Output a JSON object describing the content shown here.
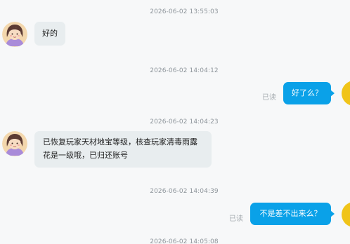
{
  "messages": [
    {
      "time": "2026-06-02 13:55:03",
      "sender": "user",
      "text": "好的"
    },
    {
      "time": "2026-06-02 14:04:12",
      "sender": "agent",
      "text": "好了么？",
      "status": "已读"
    },
    {
      "time": "2026-06-02 14:04:23",
      "sender": "user",
      "text": "已恢复玩家天材地宝等级，核查玩家清毒雨露花是一级哦，已归还账号"
    },
    {
      "time": "2026-06-02 14:04:39",
      "sender": "agent",
      "text": "不是差不出来么？",
      "status": "已读"
    },
    {
      "time": "2026-06-02 14:05:08"
    }
  ],
  "colors": {
    "background": "#f7f8f9",
    "incoming_bubble": "#e8edef",
    "outgoing_bubble": "#0aa1e8",
    "agent_avatar": "#f0c419"
  },
  "icons": {
    "user_avatar": "girl-avatar-icon",
    "agent_avatar": "agent-avatar-icon"
  }
}
